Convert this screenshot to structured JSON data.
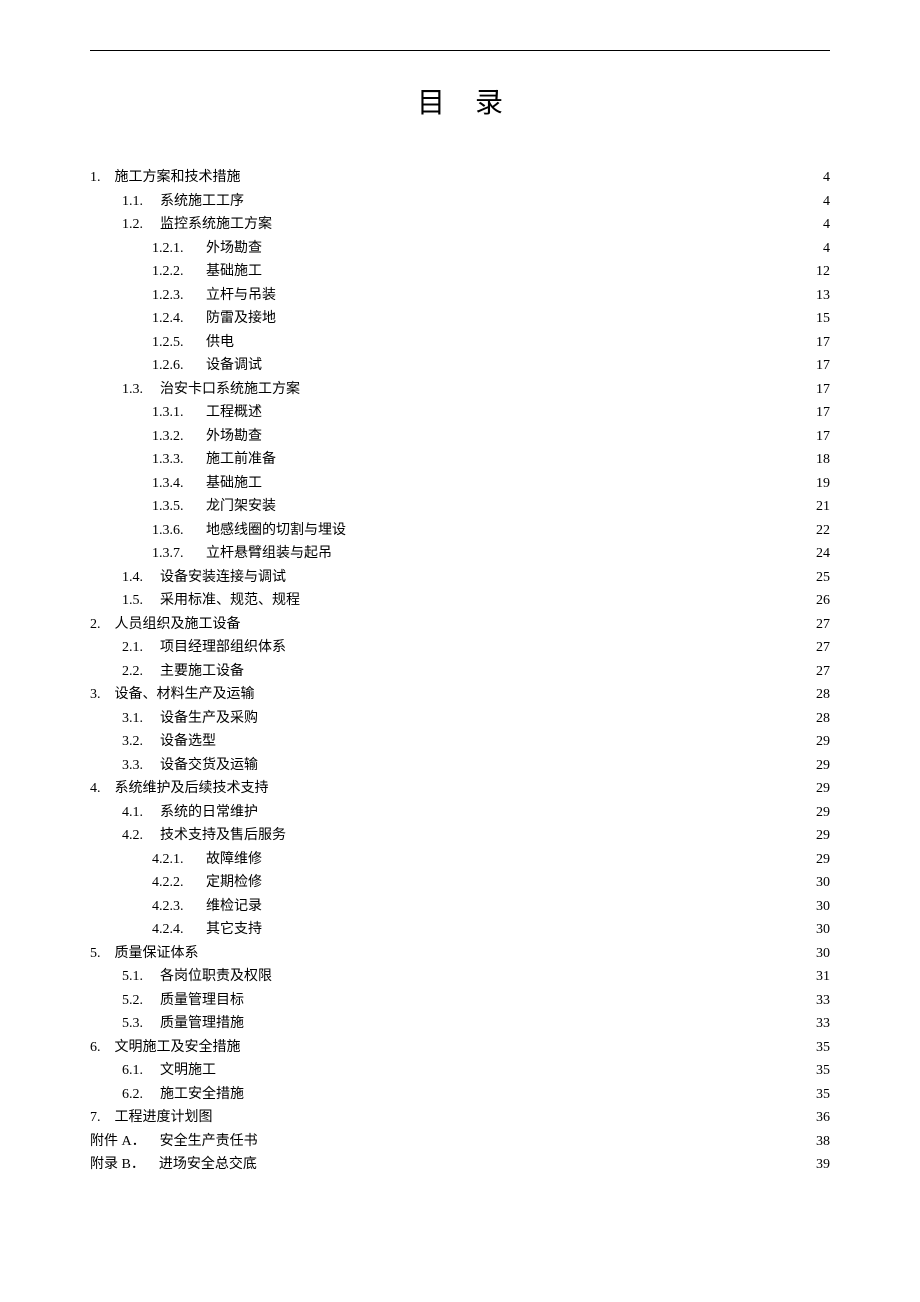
{
  "title": "目录",
  "toc": [
    {
      "level": 1,
      "num": "1.",
      "label": "施工方案和技术措施",
      "page": "4"
    },
    {
      "level": 2,
      "num": "1.1.",
      "label": "系统施工工序",
      "page": "4"
    },
    {
      "level": 2,
      "num": "1.2.",
      "label": "监控系统施工方案",
      "page": "4"
    },
    {
      "level": 3,
      "num": "1.2.1.",
      "label": "外场勘查",
      "page": "4"
    },
    {
      "level": 3,
      "num": "1.2.2.",
      "label": "基础施工",
      "page": "12"
    },
    {
      "level": 3,
      "num": "1.2.3.",
      "label": "立杆与吊装",
      "page": "13"
    },
    {
      "level": 3,
      "num": "1.2.4.",
      "label": "防雷及接地",
      "page": "15"
    },
    {
      "level": 3,
      "num": "1.2.5.",
      "label": "供电",
      "page": "17"
    },
    {
      "level": 3,
      "num": "1.2.6.",
      "label": "设备调试",
      "page": "17"
    },
    {
      "level": 2,
      "num": "1.3.",
      "label": "治安卡口系统施工方案",
      "page": "17"
    },
    {
      "level": 3,
      "num": "1.3.1.",
      "label": "工程概述",
      "page": "17"
    },
    {
      "level": 3,
      "num": "1.3.2.",
      "label": "外场勘查",
      "page": "17"
    },
    {
      "level": 3,
      "num": "1.3.3.",
      "label": "施工前准备",
      "page": "18"
    },
    {
      "level": 3,
      "num": "1.3.4.",
      "label": "基础施工",
      "page": "19"
    },
    {
      "level": 3,
      "num": "1.3.5.",
      "label": "龙门架安装",
      "page": "21"
    },
    {
      "level": 3,
      "num": "1.3.6.",
      "label": "地感线圈的切割与埋设",
      "page": "22"
    },
    {
      "level": 3,
      "num": "1.3.7.",
      "label": "立杆悬臂组装与起吊",
      "page": "24"
    },
    {
      "level": 2,
      "num": "1.4.",
      "label": "设备安装连接与调试",
      "page": "25"
    },
    {
      "level": 2,
      "num": "1.5.",
      "label": "采用标准、规范、规程",
      "page": "26"
    },
    {
      "level": 1,
      "num": "2.",
      "label": "人员组织及施工设备",
      "page": "27"
    },
    {
      "level": 2,
      "num": "2.1.",
      "label": "项目经理部组织体系",
      "page": "27"
    },
    {
      "level": 2,
      "num": "2.2.",
      "label": "主要施工设备",
      "page": "27"
    },
    {
      "level": 1,
      "num": "3.",
      "label": "设备、材料生产及运输",
      "page": "28"
    },
    {
      "level": 2,
      "num": "3.1.",
      "label": "设备生产及采购",
      "page": "28"
    },
    {
      "level": 2,
      "num": "3.2.",
      "label": "设备选型",
      "page": "29"
    },
    {
      "level": 2,
      "num": "3.3.",
      "label": "设备交货及运输",
      "page": "29"
    },
    {
      "level": 1,
      "num": "4.",
      "label": "系统维护及后续技术支持",
      "page": "29"
    },
    {
      "level": 2,
      "num": "4.1.",
      "label": "系统的日常维护",
      "page": "29"
    },
    {
      "level": 2,
      "num": "4.2.",
      "label": "技术支持及售后服务",
      "page": "29"
    },
    {
      "level": 3,
      "num": "4.2.1.",
      "label": "故障维修",
      "page": "29"
    },
    {
      "level": 3,
      "num": "4.2.2.",
      "label": "定期检修",
      "page": "30"
    },
    {
      "level": 3,
      "num": "4.2.3.",
      "label": "维检记录",
      "page": "30"
    },
    {
      "level": 3,
      "num": "4.2.4.",
      "label": "其它支持",
      "page": "30"
    },
    {
      "level": 1,
      "num": "5.",
      "label": "质量保证体系",
      "page": "30"
    },
    {
      "level": 2,
      "num": "5.1.",
      "label": "各岗位职责及权限",
      "page": "31"
    },
    {
      "level": 2,
      "num": "5.2.",
      "label": "质量管理目标",
      "page": "33"
    },
    {
      "level": 2,
      "num": "5.3.",
      "label": "质量管理措施",
      "page": "33"
    },
    {
      "level": 1,
      "num": "6.",
      "label": "文明施工及安全措施",
      "page": "35"
    },
    {
      "level": 2,
      "num": "6.1.",
      "label": "文明施工",
      "page": "35"
    },
    {
      "level": 2,
      "num": "6.2.",
      "label": "施工安全措施",
      "page": "35"
    },
    {
      "level": 1,
      "num": "7.",
      "label": "工程进度计划图",
      "page": "36"
    },
    {
      "level": "appendix",
      "num": "附件 A．",
      "label": "安全生产责任书",
      "page": "38"
    },
    {
      "level": "appendix",
      "num": "附录 B．",
      "label": "进场安全总交底",
      "page": "39"
    }
  ]
}
